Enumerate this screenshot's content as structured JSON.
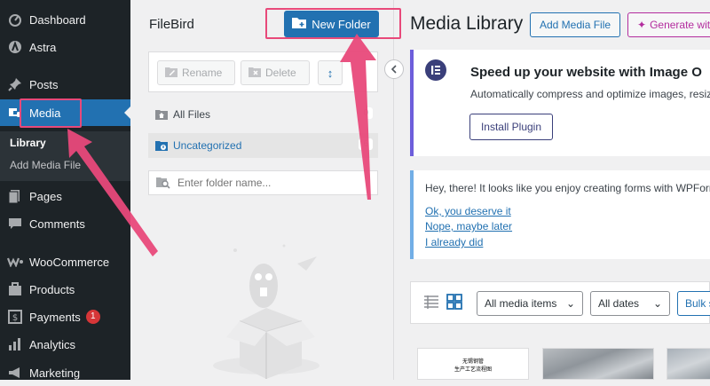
{
  "sidebar": {
    "items": [
      {
        "label": "Dashboard",
        "icon": "dashboard-icon"
      },
      {
        "label": "Astra",
        "icon": "astra-icon"
      },
      {
        "label": "Posts",
        "icon": "pin-icon"
      },
      {
        "label": "Media",
        "icon": "media-icon"
      },
      {
        "label": "Pages",
        "icon": "pages-icon"
      },
      {
        "label": "Comments",
        "icon": "comments-icon"
      },
      {
        "label": "WooCommerce",
        "icon": "woocommerce-icon"
      },
      {
        "label": "Products",
        "icon": "products-icon"
      },
      {
        "label": "Payments",
        "icon": "payments-icon",
        "badge": "1"
      },
      {
        "label": "Analytics",
        "icon": "analytics-icon"
      },
      {
        "label": "Marketing",
        "icon": "marketing-icon"
      }
    ],
    "submenu": [
      "Library",
      "Add Media File"
    ]
  },
  "filebird": {
    "title": "FileBird",
    "new_folder_label": "New Folder",
    "rename_label": "Rename",
    "delete_label": "Delete",
    "sort_label": "↕",
    "all_files_label": "All Files",
    "all_files_count": "0",
    "uncategorized_label": "Uncategorized",
    "uncategorized_count": "6",
    "search_placeholder": "Enter folder name..."
  },
  "main": {
    "title": "Media Library",
    "add_media_label": "Add Media File",
    "generate_label": "Generate with",
    "notice1": {
      "title": "Speed up your website with Image O",
      "text": "Automatically compress and optimize images, resiz",
      "button": "Install Plugin"
    },
    "notice2": {
      "text": "Hey, there! It looks like you enjoy creating forms with WPForm",
      "link1": "Ok, you deserve it",
      "link2": "Nope, maybe later",
      "link3": "I already did"
    },
    "filter": {
      "media_items": "All media items",
      "dates": "All dates",
      "bulk": "Bulk s"
    },
    "thumb1_text1": "无锡钢管",
    "thumb1_text2": "生产工艺流程图"
  },
  "colors": {
    "accent": "#2271b1",
    "highlight": "#e8497a",
    "sidebar": "#1d2327"
  }
}
